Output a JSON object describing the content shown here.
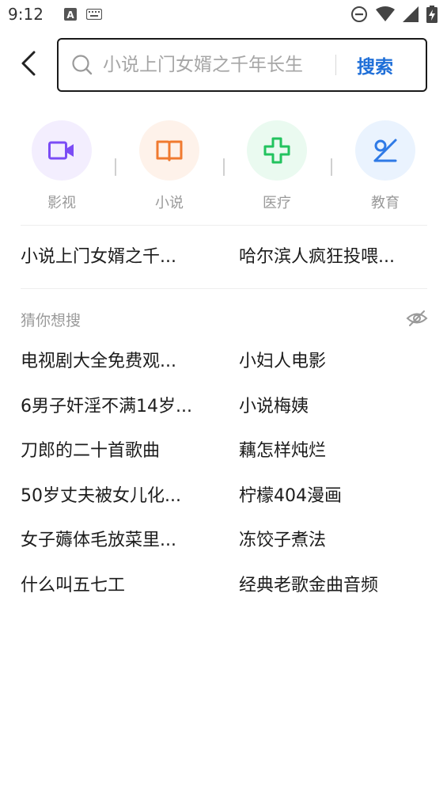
{
  "status_bar": {
    "time": "9:12"
  },
  "header": {
    "search_placeholder": "小说上门女婿之千年长生",
    "search_button": "搜索"
  },
  "categories": [
    {
      "label": "影视",
      "icon": "video-icon",
      "color": "#7b4cf5",
      "bg": "#f3eefe"
    },
    {
      "label": "小说",
      "icon": "book-icon",
      "color": "#f07a30",
      "bg": "#fef2ea"
    },
    {
      "label": "医疗",
      "icon": "medical-cross-icon",
      "color": "#22c35e",
      "bg": "#eafaf0"
    },
    {
      "label": "教育",
      "icon": "education-icon",
      "color": "#2f7ae6",
      "bg": "#eaf3fe"
    }
  ],
  "history": [
    "小说上门女婿之千...",
    "哈尔滨人疯狂投喂..."
  ],
  "guess": {
    "title": "猜你想搜",
    "items": [
      "电视剧大全免费观...",
      "小妇人电影",
      "6男子奸淫不满14岁...",
      "小说梅姨",
      "刀郎的二十首歌曲",
      "藕怎样炖烂",
      "50岁丈夫被女儿化...",
      "柠檬404漫画",
      "女子薅体毛放菜里...",
      "冻饺子煮法",
      "什么叫五七工",
      "经典老歌金曲音频"
    ]
  }
}
